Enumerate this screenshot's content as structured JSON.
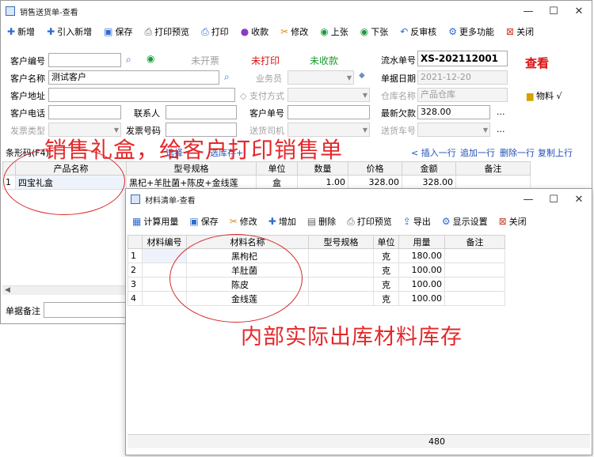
{
  "main": {
    "title": "销售送货单-查看",
    "window_controls": [
      "—",
      "☐",
      "✕"
    ],
    "toolbar": [
      {
        "label": "新增",
        "icon": "plus-icon"
      },
      {
        "label": "引入新增",
        "icon": "plus-icon"
      },
      {
        "label": "保存",
        "icon": "save-icon"
      },
      {
        "label": "打印预览",
        "icon": "print-preview-icon"
      },
      {
        "label": "打印",
        "icon": "printer-icon"
      },
      {
        "label": "收款",
        "icon": "coins-icon"
      },
      {
        "label": "修改",
        "icon": "edit-icon"
      },
      {
        "label": "上张",
        "icon": "up-icon"
      },
      {
        "label": "下张",
        "icon": "down-icon"
      },
      {
        "label": "反审核",
        "icon": "undo-icon"
      },
      {
        "label": "更多功能",
        "icon": "gear-icon"
      },
      {
        "label": "关闭",
        "icon": "close-icon"
      }
    ],
    "form": {
      "customer_no_label": "客户编号",
      "customer_no_value": "",
      "not_invoiced": "未开票",
      "not_printed": "未打印",
      "not_received": "未收款",
      "serial_label": "流水单号",
      "serial_value": "XS-202112001",
      "status_view": "查看",
      "customer_name_label": "客户名称",
      "customer_name_value": "测试客户",
      "salesman_label": "业务员",
      "date_label": "单据日期",
      "date_value": "2021-12-20",
      "address_label": "客户地址",
      "payment_label": "支付方式",
      "warehouse_label": "仓库名称",
      "warehouse_value": "产品仓库",
      "material_label": "物料 √",
      "phone_label": "客户电话",
      "contact_label": "联系人",
      "customer_order_label": "客户单号",
      "latest_debt_label": "最新欠款",
      "latest_debt_value": "328.00",
      "ellipsis": "...",
      "invoice_type_label": "发票类型",
      "invoice_no_label": "发票号码",
      "driver_label": "送货司机",
      "car_no_label": "送货车号"
    },
    "grid_toolbar": {
      "barcode_label": "条形码(F4)",
      "select_label": "选择",
      "inventory_label": "选库存+",
      "insert_row": "< 插入一行",
      "append_row": "追加一行",
      "delete_row": "删除一行",
      "copy_up": "复制上行"
    },
    "columns": [
      "产品名称",
      "型号规格",
      "单位",
      "数量",
      "价格",
      "金额",
      "备注"
    ],
    "rows": [
      {
        "idx": "1",
        "name": "四宝礼盒",
        "spec": "黑杞+羊肚菌+陈皮+金线莲",
        "unit": "盒",
        "qty": "1.00",
        "price": "328.00",
        "amount": "328.00",
        "note": ""
      }
    ],
    "remark_label": "单据备注"
  },
  "annotation_top": "销售礼盒，给客户打印销售单",
  "annotation_bottom": "内部实际出库材料库存",
  "materials": {
    "title": "材料清单-查看",
    "window_controls": [
      "—",
      "☐",
      "✕"
    ],
    "toolbar": [
      {
        "label": "计算用量",
        "icon": "calculator-icon"
      },
      {
        "label": "保存",
        "icon": "save-icon"
      },
      {
        "label": "修改",
        "icon": "edit-icon"
      },
      {
        "label": "增加",
        "icon": "plus-icon"
      },
      {
        "label": "删除",
        "icon": "trash-icon"
      },
      {
        "label": "打印预览",
        "icon": "print-preview-icon"
      },
      {
        "label": "导出",
        "icon": "export-icon"
      },
      {
        "label": "显示设置",
        "icon": "gear-icon"
      },
      {
        "label": "关闭",
        "icon": "close-icon"
      }
    ],
    "columns": [
      "材料编号",
      "材料名称",
      "型号规格",
      "单位",
      "用量",
      "备注"
    ],
    "rows": [
      {
        "idx": "1",
        "code": "",
        "name": "黑枸杞",
        "spec": "",
        "unit": "克",
        "qty": "180.00",
        "note": ""
      },
      {
        "idx": "2",
        "code": "",
        "name": "羊肚菌",
        "spec": "",
        "unit": "克",
        "qty": "100.00",
        "note": ""
      },
      {
        "idx": "3",
        "code": "",
        "name": "陈皮",
        "spec": "",
        "unit": "克",
        "qty": "100.00",
        "note": ""
      },
      {
        "idx": "4",
        "code": "",
        "name": "金线莲",
        "spec": "",
        "unit": "克",
        "qty": "100.00",
        "note": ""
      }
    ],
    "total_qty": "480"
  }
}
